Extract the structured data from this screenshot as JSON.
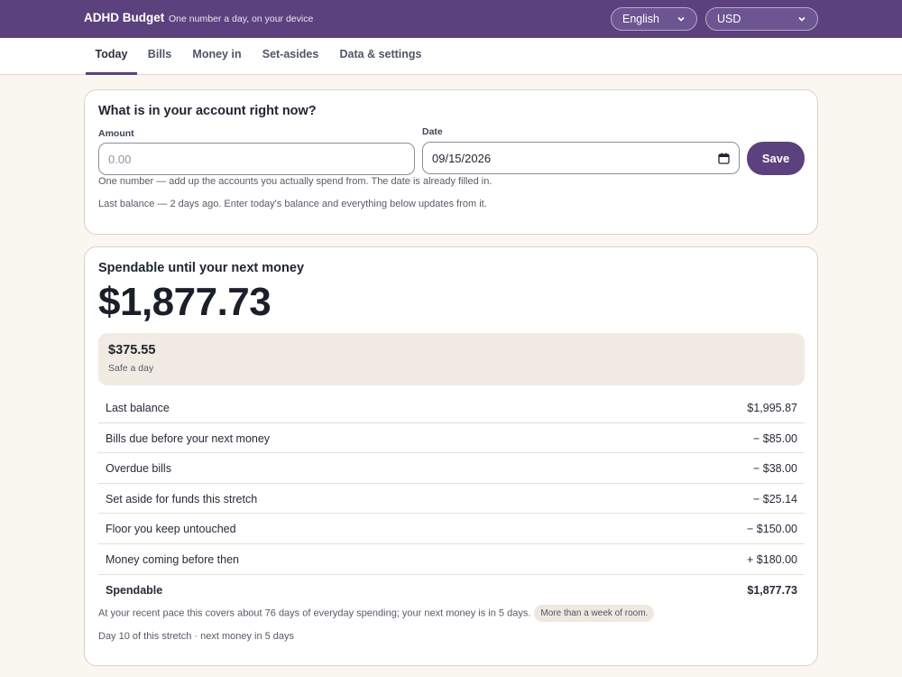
{
  "header": {
    "brand": "ADHD Budget",
    "tagline": "One number a day, on your device",
    "language_selected": "English",
    "currency_selected": "USD"
  },
  "tabs": [
    {
      "label": "Today",
      "active": true
    },
    {
      "label": "Bills",
      "active": false
    },
    {
      "label": "Money in",
      "active": false
    },
    {
      "label": "Set-asides",
      "active": false
    },
    {
      "label": "Data & settings",
      "active": false
    }
  ],
  "balance_card": {
    "title": "What is in your account right now?",
    "amount_label": "Amount",
    "amount_placeholder": "0.00",
    "date_label": "Date",
    "date_value": "09/15/2026",
    "save_label": "Save",
    "hint": "One number — add up the accounts you actually spend from. The date is already filled in.",
    "last_balance_note": "Last balance — 2 days ago. Enter today's balance and everything below updates from it."
  },
  "spendable_card": {
    "title": "Spendable until your next money",
    "amount": "$1,877.73",
    "safe_per_day": "$375.55",
    "safe_label": "Safe a day",
    "rows": [
      {
        "label": "Last balance",
        "value": "$1,995.87"
      },
      {
        "label": "Bills due before your next money",
        "value": "− $85.00"
      },
      {
        "label": "Overdue bills",
        "value": "− $38.00"
      },
      {
        "label": "Set aside for funds this stretch",
        "value": "− $25.14"
      },
      {
        "label": "Floor you keep untouched",
        "value": "− $150.00"
      },
      {
        "label": "Money coming before then",
        "value": "+ $180.00"
      },
      {
        "label": "Spendable",
        "value": "$1,877.73"
      }
    ],
    "pace_note": "At your recent pace this covers about 76 days of everyday spending; your next money is in 5 days.",
    "pace_badge": "More than a week of room.",
    "stretch_note": "Day 10 of this stretch · next money in 5 days"
  },
  "colors": {
    "brand_purple": "#5b427e",
    "page_bg": "#faf7f1",
    "safe_box_bg": "#f2ebe3"
  }
}
